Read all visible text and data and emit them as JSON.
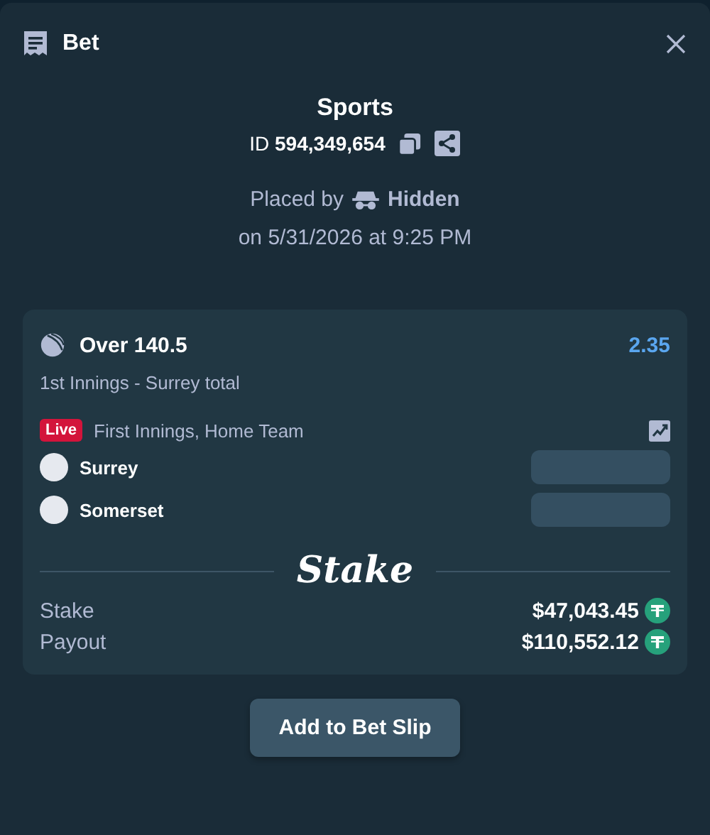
{
  "header": {
    "title": "Bet"
  },
  "summary": {
    "title": "Sports",
    "id_label": "ID",
    "id_value": "594,349,654",
    "placed_by_label": "Placed by",
    "placed_by_user": "Hidden",
    "placed_on": "on 5/31/2026 at 9:25 PM"
  },
  "bet": {
    "selection": "Over 140.5",
    "odds": "2.35",
    "market": "1st Innings - Surrey total",
    "live_badge": "Live",
    "event": "First Innings, Home Team",
    "teams": [
      {
        "name": "Surrey"
      },
      {
        "name": "Somerset"
      }
    ],
    "brand": "Stake",
    "amounts": [
      {
        "label": "Stake",
        "value": "$47,043.45"
      },
      {
        "label": "Payout",
        "value": "$110,552.12"
      }
    ]
  },
  "action": {
    "label": "Add to Bet Slip"
  }
}
